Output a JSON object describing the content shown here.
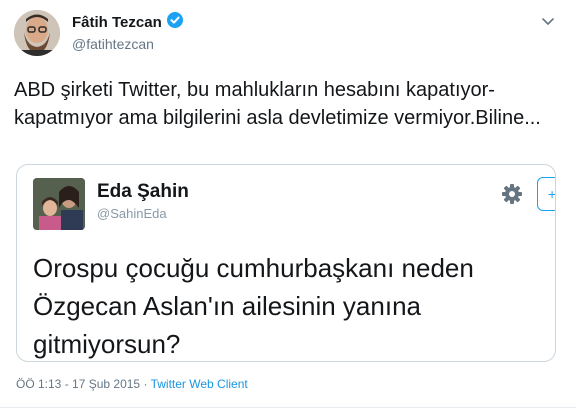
{
  "tweet": {
    "author_name": "Fâtih Tezcan",
    "author_handle": "@fatihtezcan",
    "text": "ABD şirketi Twitter, bu mahlukların hesabını kapatıyor-kapatmıyor ama bilgilerini asla devletimize vermiyor.Biline...",
    "timestamp": "ÖÖ 1:13 - 17 Şub 2015",
    "separator": "·",
    "client": "Twitter Web Client"
  },
  "quoted": {
    "author_name": "Eda Şahin",
    "author_handle": "@SahinEda",
    "text": "Orospu çocuğu cumhurbaşkanı neden Özgecan Aslan'ın ailesinin yanına gitmiyorsun?",
    "follow_label": "+"
  },
  "colors": {
    "link": "#1b95e0",
    "verified": "#1da1f2",
    "muted": "#657786"
  },
  "icons": [
    "verified-badge-icon",
    "chevron-down-icon",
    "gear-icon",
    "follow-icon"
  ]
}
